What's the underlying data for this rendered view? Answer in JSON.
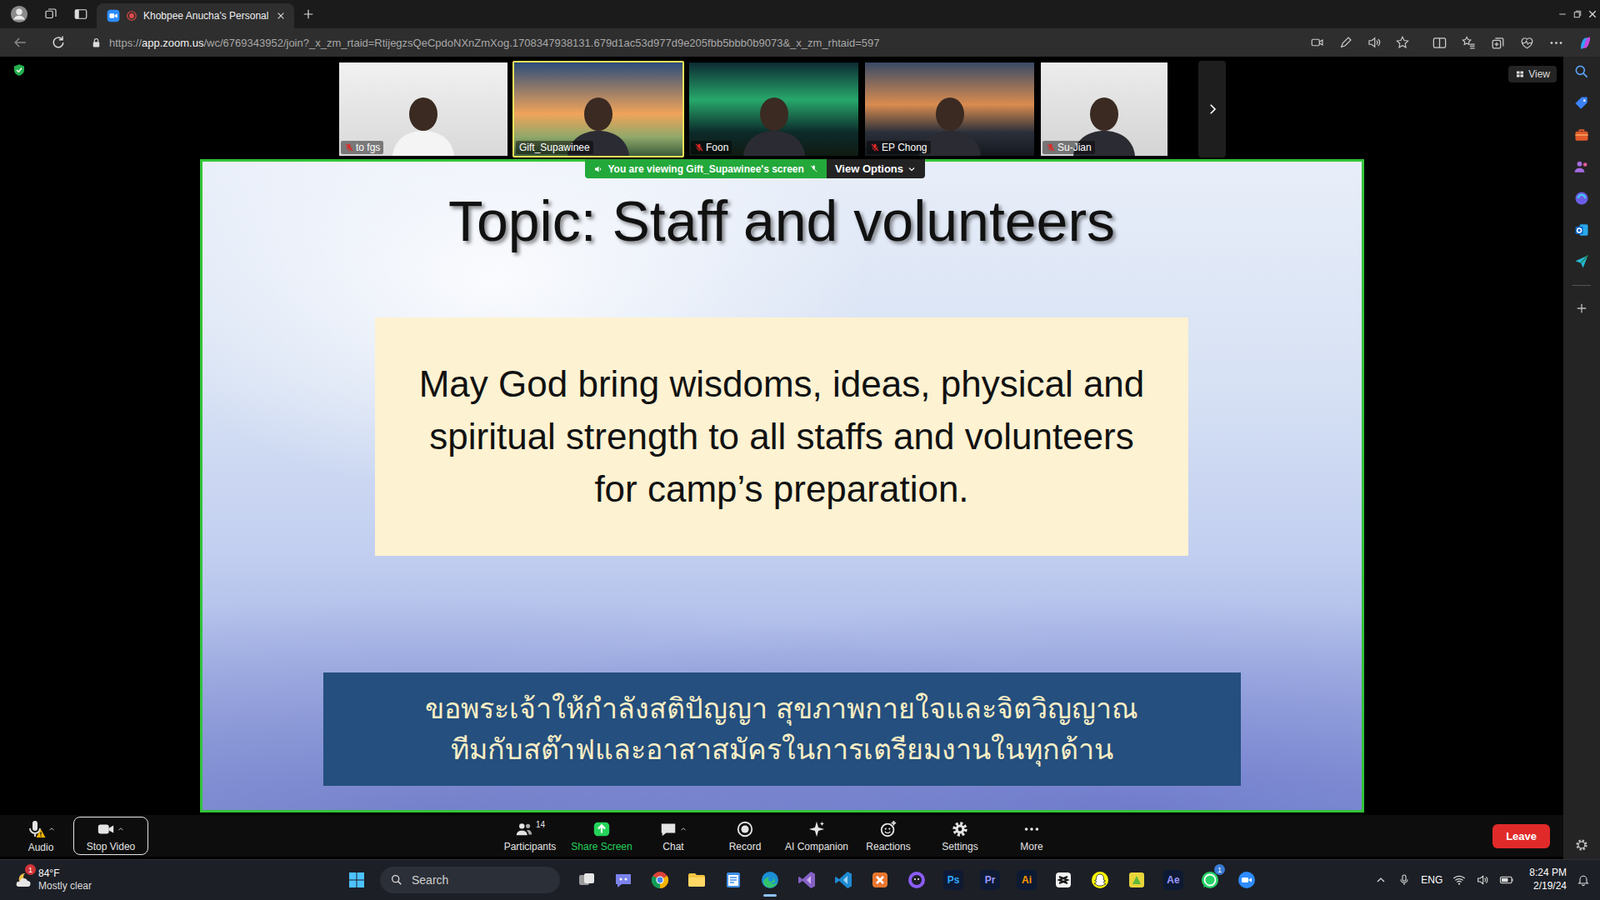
{
  "browser": {
    "tab": {
      "title": "Khobpee Anucha's Personal",
      "recording": true
    },
    "url_prefix": "https://",
    "url_host": "app.zoom.us",
    "url_path": "/wc/6769343952/join?_x_zm_rtaid=RtijegzsQeCpdoNXnZmXog.1708347938131.679d1ac53d977d9e205fbb5bbb0b9073&_x_zm_rhtaid=597"
  },
  "zoom": {
    "view_button": "View",
    "participants": [
      {
        "name": "to fgs",
        "muted": true,
        "speaking": false
      },
      {
        "name": "Gift_Supawinee",
        "muted": false,
        "speaking": true
      },
      {
        "name": "Foon",
        "muted": true,
        "speaking": false
      },
      {
        "name": "EP Chong",
        "muted": true,
        "speaking": false
      },
      {
        "name": "Su-Jian",
        "muted": true,
        "speaking": false
      }
    ],
    "share_banner": {
      "text": "You are viewing  Gift_Supawinee's screen",
      "options": "View Options"
    },
    "slide": {
      "title": "Topic: Staff and volunteers",
      "prayer_en": [
        "May God bring wisdoms, ideas, physical and",
        "spiritual strength to all staffs and volunteers",
        "for camp’s preparation."
      ],
      "prayer_th": [
        "ขอพระเจ้าให้กำลังสติปัญญา สุขภาพกายใจและจิตวิญญาณ",
        "ทีมกับสต๊าฟและอาสาสมัครในการเตรียมงานในทุกด้าน"
      ]
    },
    "toolbar": {
      "left": [
        {
          "label": "Audio",
          "kind": "audio",
          "warning": true,
          "outlined": false,
          "caret": true
        },
        {
          "label": "Stop Video",
          "kind": "video",
          "warning": false,
          "outlined": true,
          "caret": true
        }
      ],
      "center": [
        {
          "label": "Participants",
          "kind": "participants",
          "count": "14",
          "highlight": false,
          "caret": false
        },
        {
          "label": "Share Screen",
          "kind": "share",
          "highlight": true,
          "caret": false
        },
        {
          "label": "Chat",
          "kind": "chat",
          "highlight": false,
          "caret": true
        },
        {
          "label": "Record",
          "kind": "record",
          "highlight": false,
          "caret": false
        },
        {
          "label": "AI Companion",
          "kind": "ai",
          "highlight": false,
          "caret": false
        },
        {
          "label": "Reactions",
          "kind": "reactions",
          "highlight": false,
          "caret": false
        },
        {
          "label": "Settings",
          "kind": "settings",
          "highlight": false,
          "caret": false
        },
        {
          "label": "More",
          "kind": "more",
          "highlight": false,
          "caret": false
        }
      ],
      "leave": "Leave"
    }
  },
  "taskbar": {
    "weather": {
      "temp": "84°F",
      "desc": "Mostly clear",
      "badge": "1"
    },
    "search": "Search",
    "apps": [
      {
        "kind": "taskview",
        "active": false
      },
      {
        "kind": "chat",
        "active": false
      },
      {
        "kind": "chrome",
        "active": false
      },
      {
        "kind": "explorer",
        "active": false
      },
      {
        "kind": "notepad",
        "active": false
      },
      {
        "kind": "edge",
        "active": true
      },
      {
        "kind": "vs",
        "active": false
      },
      {
        "kind": "vscode",
        "active": false
      },
      {
        "kind": "orange",
        "active": false
      },
      {
        "kind": "github",
        "active": false
      },
      {
        "kind": "adobe",
        "label": "Ps",
        "color": "#31a8ff",
        "active": false
      },
      {
        "kind": "adobe",
        "label": "Pr",
        "color": "#9999ff",
        "active": false
      },
      {
        "kind": "adobe",
        "label": "Ai",
        "color": "#ff9a00",
        "active": false
      },
      {
        "kind": "capcut",
        "active": false
      },
      {
        "kind": "snapchat",
        "active": false
      },
      {
        "kind": "sticky",
        "active": false
      },
      {
        "kind": "adobe",
        "label": "Ae",
        "color": "#9999ff",
        "active": false
      },
      {
        "kind": "whatsapp",
        "badge": "1",
        "active": false
      },
      {
        "kind": "zoom",
        "active": false
      }
    ],
    "tray": {
      "language": "ENG",
      "time": "8:24 PM",
      "date": "2/19/24"
    }
  }
}
